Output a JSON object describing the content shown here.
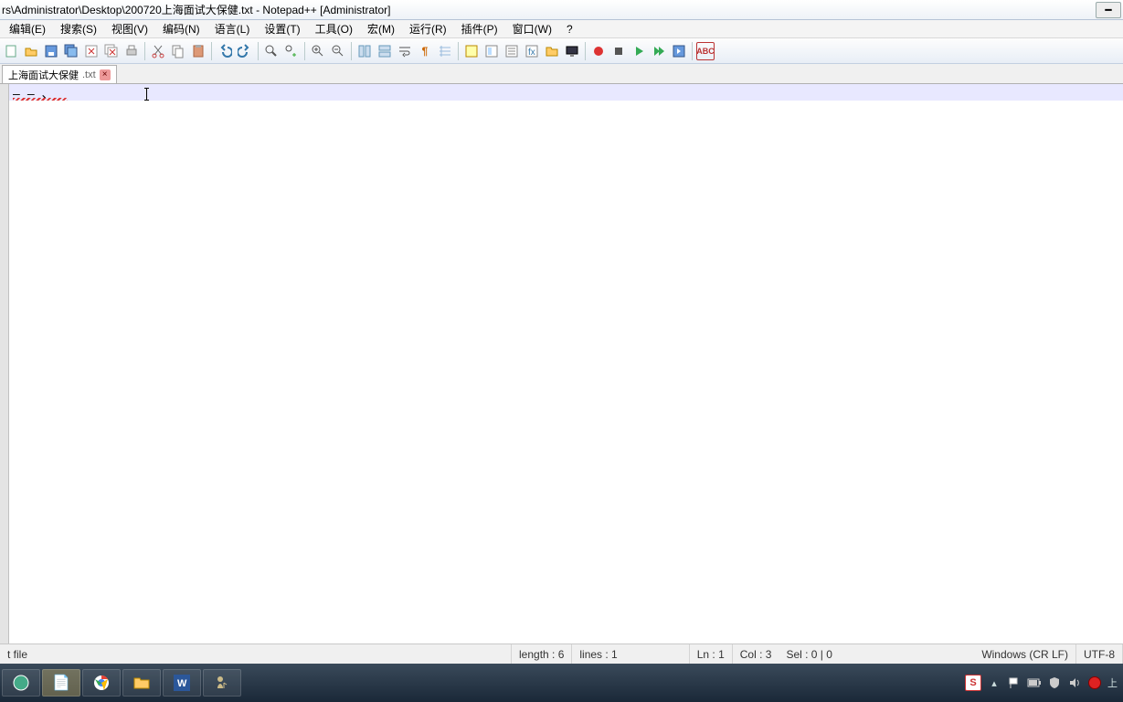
{
  "title": "rs\\Administrator\\Desktop\\200720上海面试大保健.txt - Notepad++ [Administrator]",
  "menu": {
    "edit": "编辑(E)",
    "search": "搜索(S)",
    "view": "视图(V)",
    "encoding": "编码(N)",
    "language": "语言(L)",
    "settings": "设置(T)",
    "tools": "工具(O)",
    "macro": "宏(M)",
    "run": "运行(R)",
    "plugins": "插件(P)",
    "window": "窗口(W)",
    "help": "?"
  },
  "tab": {
    "name": "上海面试大保健",
    "ext": ".txt"
  },
  "content_line1": "——、",
  "status": {
    "filetype": "t file",
    "length": "length : 6",
    "lines": "lines : 1",
    "ln": "Ln : 1",
    "col": "Col : 3",
    "sel": "Sel : 0 | 0",
    "eol": "Windows (CR LF)",
    "enc": "UTF-8"
  },
  "tray_text": "上"
}
